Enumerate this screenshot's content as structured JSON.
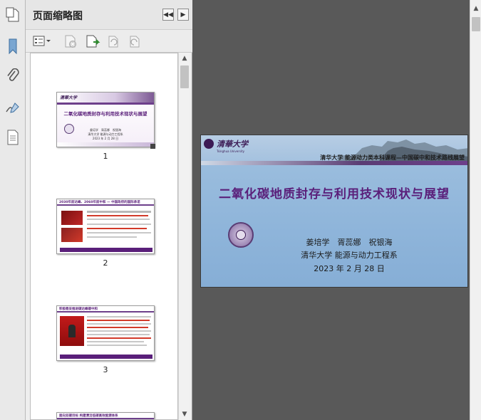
{
  "panel": {
    "title": "页面缩略图"
  },
  "thumbnails": [
    {
      "page": "1",
      "title": "二氧化碳地质封存与利用技术现状与展望",
      "authors": "姜培学　胥蕊娜　祝银海",
      "dept": "清华大学 能源与动力工程系",
      "date": "2023 年 2 月 28 日"
    },
    {
      "page": "2",
      "title": "2030年前达峰、2060年前中和 — 中国政府的国际承诺"
    },
    {
      "page": "3",
      "title": "积极稳妥推进碳达峰碳中和"
    },
    {
      "page": "4",
      "title": "面向双碳目标  构建清洁低碳高效能源体系"
    }
  ],
  "slide": {
    "logo_text": "清華大学",
    "logo_en": "Tsinghua University",
    "subtitle": "清华大学 能源动力类本科课程—中国碳中和技术路线展望",
    "title": "二氧化碳地质封存与利用技术现状与展望",
    "authors": "姜培学　胥蕊娜　祝银海",
    "dept": "清华大学 能源与动力工程系",
    "date": "2023 年 2 月 28 日"
  },
  "colors": {
    "accent_purple": "#5a1f7a",
    "slide_bg": "#8fb5da",
    "thumb_red": "#b3121b"
  }
}
